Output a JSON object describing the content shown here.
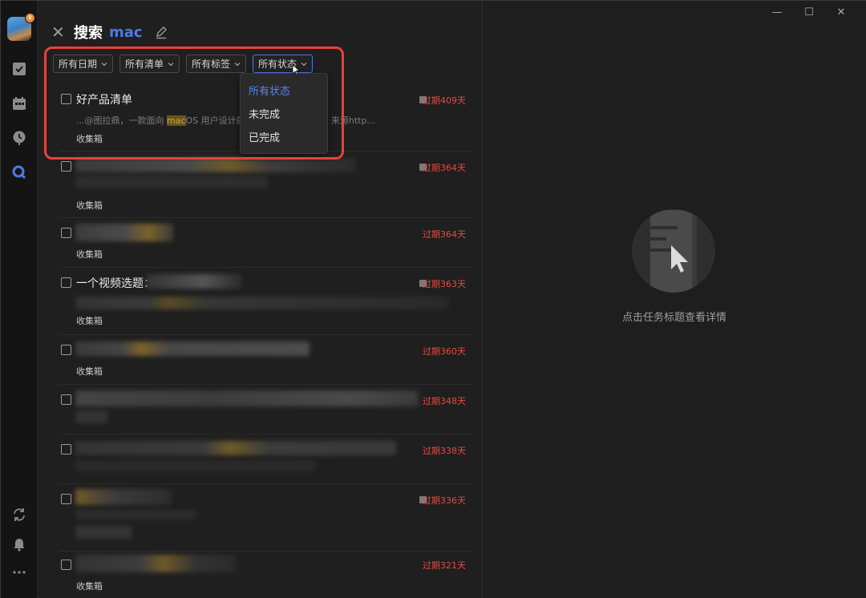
{
  "window": {
    "minimize": "—",
    "maximize": "☐",
    "close": "✕"
  },
  "search": {
    "title": "搜索",
    "query": "mac"
  },
  "filters": [
    {
      "label": "所有日期"
    },
    {
      "label": "所有清单"
    },
    {
      "label": "所有标签"
    },
    {
      "label": "所有状态"
    }
  ],
  "status_dropdown": {
    "options": [
      "所有状态",
      "未完成",
      "已完成"
    ],
    "selected": "所有状态"
  },
  "tasks": [
    {
      "title": "好产品清单",
      "snippet_prefix": "...@图拉鼎，一款面向 ",
      "snippet_highlight": "mac",
      "snippet_mid": "OS 用户设计的",
      "snippet_suffix": "+时间进度的 App。 来源http...",
      "list": "收集箱",
      "due": "过期409天",
      "has_note": true
    },
    {
      "title": "",
      "list": "收集箱",
      "due": "过期364天",
      "has_note": true
    },
    {
      "title": "",
      "list": "收集箱",
      "due": "过期364天",
      "has_note": false
    },
    {
      "title": "一个视频选题：",
      "list": "收集箱",
      "due": "过期363天",
      "has_note": true
    },
    {
      "title": "",
      "list": "收集箱",
      "due": "过期360天",
      "has_note": false
    },
    {
      "title": "",
      "list": "",
      "due": "过期348天",
      "has_note": false
    },
    {
      "title": "",
      "list": "",
      "due": "过期338天",
      "has_note": false
    },
    {
      "title": "",
      "list": "",
      "due": "过期336天",
      "has_note": true
    },
    {
      "title": "",
      "list": "收集箱",
      "due": "过期321天",
      "has_note": false
    }
  ],
  "empty_state": {
    "text": "点击任务标题查看详情"
  },
  "icons": {
    "rail": [
      "checkbox-icon",
      "calendar-icon",
      "clock-icon",
      "search-icon",
      "sync-icon",
      "bell-icon",
      "more-icon"
    ]
  },
  "colors": {
    "accent": "#4f79e8",
    "overdue": "#e64a42",
    "highlight_box": "#e8413b"
  }
}
